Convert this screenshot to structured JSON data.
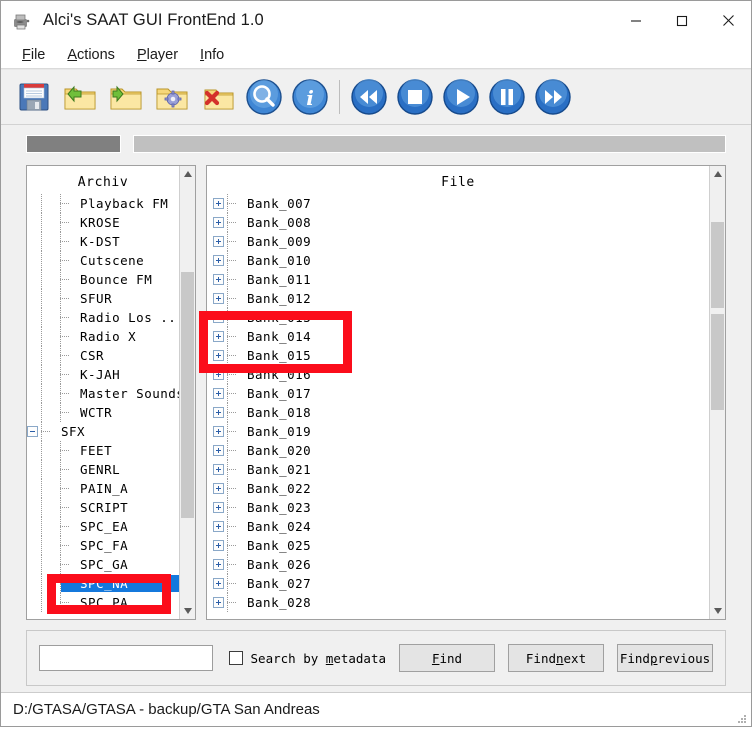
{
  "window": {
    "title": "Alci's SAAT GUI FrontEnd 1.0",
    "app_icon": "saat-app-icon",
    "controls": [
      {
        "name": "minimize",
        "glyph": "minimize-icon"
      },
      {
        "name": "maximize",
        "glyph": "maximize-icon"
      },
      {
        "name": "close",
        "glyph": "close-icon"
      }
    ]
  },
  "menubar": {
    "items": [
      {
        "label": "File",
        "mnemonic": "F"
      },
      {
        "label": "Actions",
        "mnemonic": "A"
      },
      {
        "label": "Player",
        "mnemonic": "P"
      },
      {
        "label": "Info",
        "mnemonic": "I"
      }
    ]
  },
  "toolbar": {
    "buttons": [
      {
        "name": "save-icon",
        "title": "Save"
      },
      {
        "name": "folder-open-icon",
        "title": "Open"
      },
      {
        "name": "folder-export-icon",
        "title": "Export"
      },
      {
        "name": "folder-settings-icon",
        "title": "Settings"
      },
      {
        "name": "folder-delete-icon",
        "title": "Delete"
      },
      {
        "name": "search-icon",
        "title": "Search"
      },
      {
        "name": "info-icon",
        "title": "Info"
      },
      {
        "name": "rewind-icon",
        "title": "Rewind"
      },
      {
        "name": "stop-icon",
        "title": "Stop"
      },
      {
        "name": "play-icon",
        "title": "Play"
      },
      {
        "name": "pause-icon",
        "title": "Pause"
      },
      {
        "name": "forward-icon",
        "title": "Forward"
      }
    ]
  },
  "progress": {
    "segment_color": "#808080",
    "track_color": "#c0c0c0"
  },
  "archive_panel": {
    "header": "Archiv",
    "items": [
      {
        "label": "Playback FM",
        "level": 1,
        "expander": "none"
      },
      {
        "label": "KROSE",
        "level": 1,
        "expander": "none"
      },
      {
        "label": "K-DST",
        "level": 1,
        "expander": "none"
      },
      {
        "label": "Cutscene",
        "level": 1,
        "expander": "none"
      },
      {
        "label": "Bounce FM",
        "level": 1,
        "expander": "none"
      },
      {
        "label": "SFUR",
        "level": 1,
        "expander": "none"
      },
      {
        "label": "Radio Los ...",
        "level": 1,
        "expander": "none"
      },
      {
        "label": "Radio X",
        "level": 1,
        "expander": "none"
      },
      {
        "label": "CSR",
        "level": 1,
        "expander": "none"
      },
      {
        "label": "K-JAH",
        "level": 1,
        "expander": "none"
      },
      {
        "label": "Master Sounds",
        "level": 1,
        "expander": "none"
      },
      {
        "label": "WCTR",
        "level": 1,
        "expander": "none"
      },
      {
        "label": "SFX",
        "level": 0,
        "expander": "minus"
      },
      {
        "label": "FEET",
        "level": 1,
        "expander": "none"
      },
      {
        "label": "GENRL",
        "level": 1,
        "expander": "none"
      },
      {
        "label": "PAIN_A",
        "level": 1,
        "expander": "none"
      },
      {
        "label": "SCRIPT",
        "level": 1,
        "expander": "none"
      },
      {
        "label": "SPC_EA",
        "level": 1,
        "expander": "none"
      },
      {
        "label": "SPC_FA",
        "level": 1,
        "expander": "none"
      },
      {
        "label": "SPC_GA",
        "level": 1,
        "expander": "none"
      },
      {
        "label": "SPC_NA",
        "level": 1,
        "expander": "none",
        "selected": true
      },
      {
        "label": "SPC_PA",
        "level": 1,
        "expander": "none"
      }
    ],
    "selected_item": "SPC_NA",
    "selection_color": "#1478dc"
  },
  "file_panel": {
    "header": "File",
    "items": [
      {
        "label": "Bank_007",
        "expander": "plus"
      },
      {
        "label": "Bank_008",
        "expander": "plus"
      },
      {
        "label": "Bank_009",
        "expander": "plus"
      },
      {
        "label": "Bank_010",
        "expander": "plus"
      },
      {
        "label": "Bank_011",
        "expander": "plus"
      },
      {
        "label": "Bank_012",
        "expander": "plus"
      },
      {
        "label": "Bank_013",
        "expander": "plus"
      },
      {
        "label": "Bank_014",
        "expander": "plus"
      },
      {
        "label": "Bank_015",
        "expander": "plus"
      },
      {
        "label": "Bank_016",
        "expander": "plus"
      },
      {
        "label": "Bank_017",
        "expander": "plus"
      },
      {
        "label": "Bank_018",
        "expander": "plus"
      },
      {
        "label": "Bank_019",
        "expander": "plus"
      },
      {
        "label": "Bank_020",
        "expander": "plus"
      },
      {
        "label": "Bank_021",
        "expander": "plus"
      },
      {
        "label": "Bank_022",
        "expander": "plus"
      },
      {
        "label": "Bank_023",
        "expander": "plus"
      },
      {
        "label": "Bank_024",
        "expander": "plus"
      },
      {
        "label": "Bank_025",
        "expander": "plus"
      },
      {
        "label": "Bank_026",
        "expander": "plus"
      },
      {
        "label": "Bank_027",
        "expander": "plus"
      },
      {
        "label": "Bank_028",
        "expander": "plus"
      }
    ]
  },
  "search": {
    "value": "",
    "placeholder": "",
    "checkbox": {
      "label_before": "Search by ",
      "mnemonic": "m",
      "label_after": "etadata",
      "checked": false
    },
    "buttons": [
      {
        "label_before": "",
        "mnemonic": "F",
        "label_after": "ind"
      },
      {
        "label_before": "Find ",
        "mnemonic": "n",
        "label_after": "ext"
      },
      {
        "label_before": "Find ",
        "mnemonic": "p",
        "label_after": "revious"
      }
    ]
  },
  "statusbar": {
    "path": "D:/GTASA/GTASA - backup/GTA San Andreas"
  },
  "annotations": {
    "color": "#fb0d1b",
    "boxes": [
      {
        "name": "redbox-banks",
        "targets": "Bank_013, Bank_014"
      },
      {
        "name": "redbox-spcna",
        "targets": "SPC_NA"
      }
    ]
  }
}
